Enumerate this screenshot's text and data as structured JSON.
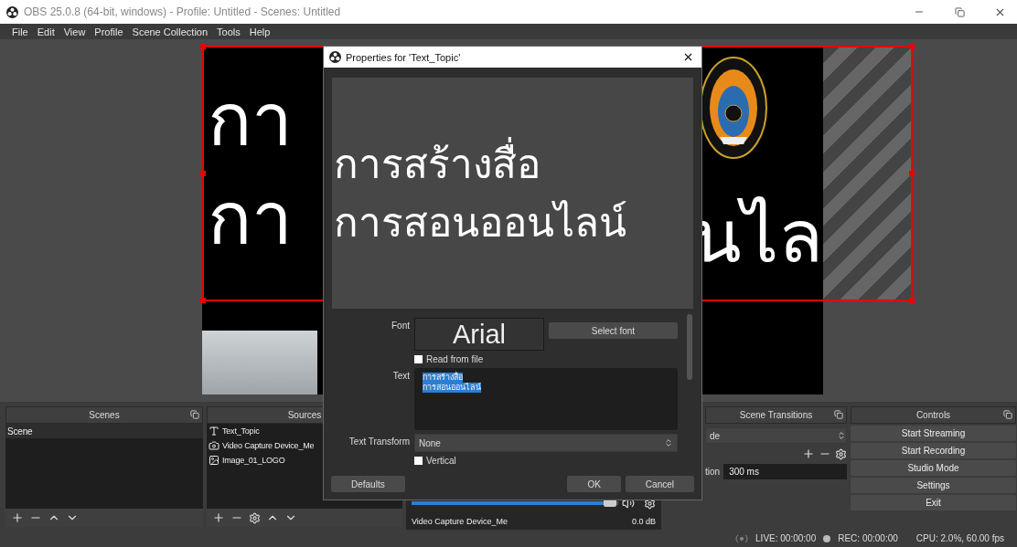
{
  "window": {
    "title": "OBS 25.0.8 (64-bit, windows) - Profile: Untitled - Scenes: Untitled"
  },
  "menu": [
    "File",
    "Edit",
    "View",
    "Profile",
    "Scene Collection",
    "Tools",
    "Help"
  ],
  "preview": {
    "left_lines": [
      "กา",
      "กา"
    ],
    "right_text": "นไล",
    "selected": true
  },
  "scenes": {
    "title": "Scenes",
    "items": [
      {
        "label": "Scene",
        "selected": true
      }
    ]
  },
  "sources": {
    "title": "Sources",
    "items": [
      {
        "label": "Text_Topic",
        "kind": "text",
        "selected": false
      },
      {
        "label": "Video Capture Device_Me",
        "kind": "camera",
        "selected": false
      },
      {
        "label": "Image_01_LOGO",
        "kind": "image",
        "selected": false
      }
    ]
  },
  "mixer": {
    "source": "Video Capture Device_Me",
    "reading": "0.0 dB",
    "level": 0.96
  },
  "transitions": {
    "title": "Scene Transitions",
    "transition": "de",
    "duration_label": "tion",
    "duration": "300 ms"
  },
  "controls": {
    "title": "Controls",
    "buttons": [
      "Start Streaming",
      "Start Recording",
      "Studio Mode",
      "Settings",
      "Exit"
    ]
  },
  "status": {
    "live": "LIVE: 00:00:00",
    "rec": "REC: 00:00:00",
    "cpu": "CPU: 2.0%, 60.00 fps"
  },
  "dialog": {
    "title": "Properties for 'Text_Topic'",
    "preview_lines": [
      "การสร้างสื่อ",
      "การสอนออนไลน์"
    ],
    "font_label": "Font",
    "font": "Arial",
    "select_font": "Select font",
    "read_from_file": {
      "label": "Read from file",
      "checked": false
    },
    "text_label": "Text",
    "text_lines": [
      "การสร้างสื่อ",
      "การสอนออนไลน์"
    ],
    "text_selected": true,
    "transform_label": "Text Transform",
    "transform": "None",
    "vertical": {
      "label": "Vertical",
      "checked": false
    },
    "buttons": [
      "Defaults",
      "OK",
      "Cancel"
    ]
  }
}
